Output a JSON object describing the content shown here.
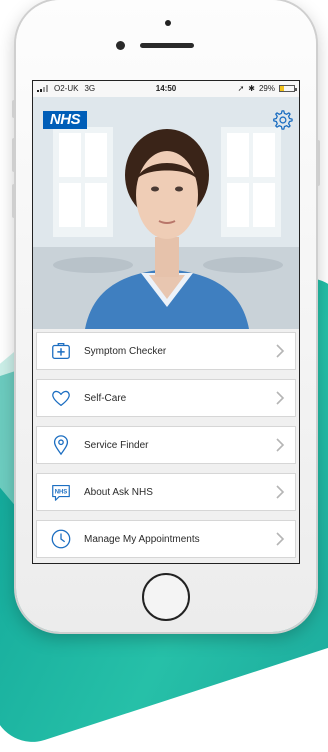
{
  "status_bar": {
    "carrier": "O2-UK",
    "network": "3G",
    "time": "14:50",
    "battery": "29%",
    "battery_level": 0.29
  },
  "header": {
    "logo_text": "NHS"
  },
  "menu": {
    "items": [
      {
        "label": "Symptom Checker",
        "icon": "medical-kit-icon"
      },
      {
        "label": "Self-Care",
        "icon": "heart-icon"
      },
      {
        "label": "Service Finder",
        "icon": "location-pin-icon"
      },
      {
        "label": "About Ask NHS",
        "icon": "nhs-badge-icon"
      },
      {
        "label": "Manage My Appointments",
        "icon": "clock-icon"
      }
    ]
  },
  "colors": {
    "nhs_blue": "#005eb8",
    "icon_blue": "#1c6ec1",
    "teal_background": "#1aa59a",
    "battery_yellow": "#f1c21b"
  }
}
